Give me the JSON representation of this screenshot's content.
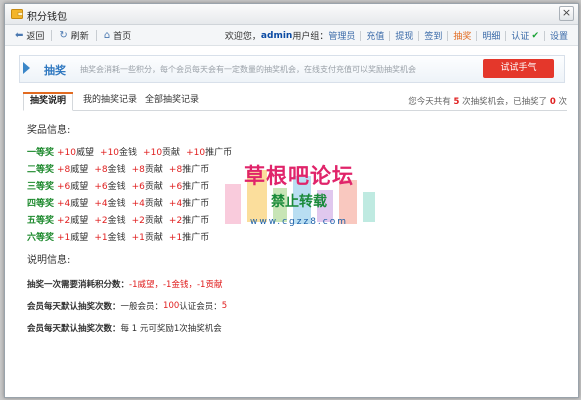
{
  "window": {
    "title": "积分钱包",
    "close": "×"
  },
  "toolbar": {
    "back": "返回",
    "refresh": "刷新",
    "home": "首页",
    "welcome": "欢迎您，",
    "username": "admin",
    "group_label": "用户组：",
    "group_value": "管理员",
    "links": [
      "充值",
      "提现",
      "签到",
      "抽奖",
      "明细",
      "认证"
    ],
    "active_link": "抽奖",
    "settings": "设置"
  },
  "banner": {
    "title": "抽奖",
    "desc": "抽奖会消耗一些积分，每个会员每天会有一定数量的抽奖机会，在线支付充值可以奖励抽奖机会",
    "button": "试试手气"
  },
  "tabs": {
    "items": [
      "抽奖说明",
      "我的抽奖记录",
      "全部抽奖记录"
    ],
    "active": "抽奖说明",
    "stat_prefix": "您今天共有",
    "stat_total": "5",
    "stat_mid": "次抽奖机会，已抽奖了",
    "stat_used": "0",
    "stat_suffix": "次"
  },
  "prizes": {
    "heading": "奖品信息:",
    "rows": [
      {
        "level": "一等奖",
        "rewards": [
          "+10威望",
          "+10金钱",
          "+10贡献",
          "+10推广币"
        ]
      },
      {
        "level": "二等奖",
        "rewards": [
          "+8威望",
          "+8金钱",
          "+8贡献",
          "+8推广币"
        ]
      },
      {
        "level": "三等奖",
        "rewards": [
          "+6威望",
          "+6金钱",
          "+6贡献",
          "+6推广币"
        ]
      },
      {
        "level": "四等奖",
        "rewards": [
          "+4威望",
          "+4金钱",
          "+4贡献",
          "+4推广币"
        ]
      },
      {
        "level": "五等奖",
        "rewards": [
          "+2威望",
          "+2金钱",
          "+2贡献",
          "+2推广币"
        ]
      },
      {
        "level": "六等奖",
        "rewards": [
          "+1威望",
          "+1金钱",
          "+1贡献",
          "+1推广币"
        ]
      }
    ]
  },
  "notes": {
    "heading": "说明信息:",
    "cost_label": "抽奖一次需要消耗积分数：",
    "cost_value": "-1威望，-1金钱，-1贡献",
    "default_label": "会员每天默认抽奖次数：",
    "default_normal": "一般会员：",
    "default_normal_value": "100",
    "default_verified": " 认证会员：",
    "default_verified_value": "5",
    "pay_label": "会员每天默认抽奖次数：",
    "pay_value": "每 1 元可奖励1次抽奖机会"
  },
  "watermark": {
    "line1": "草根吧论坛",
    "line2": "禁止转载",
    "line3": "www.cgzz8.com"
  },
  "colors": {
    "accent": "#e26b21",
    "button_red": "#e4372b",
    "level_green": "#1e8a2e",
    "reward_red": "#e02020",
    "link_blue": "#3a6aa8"
  }
}
